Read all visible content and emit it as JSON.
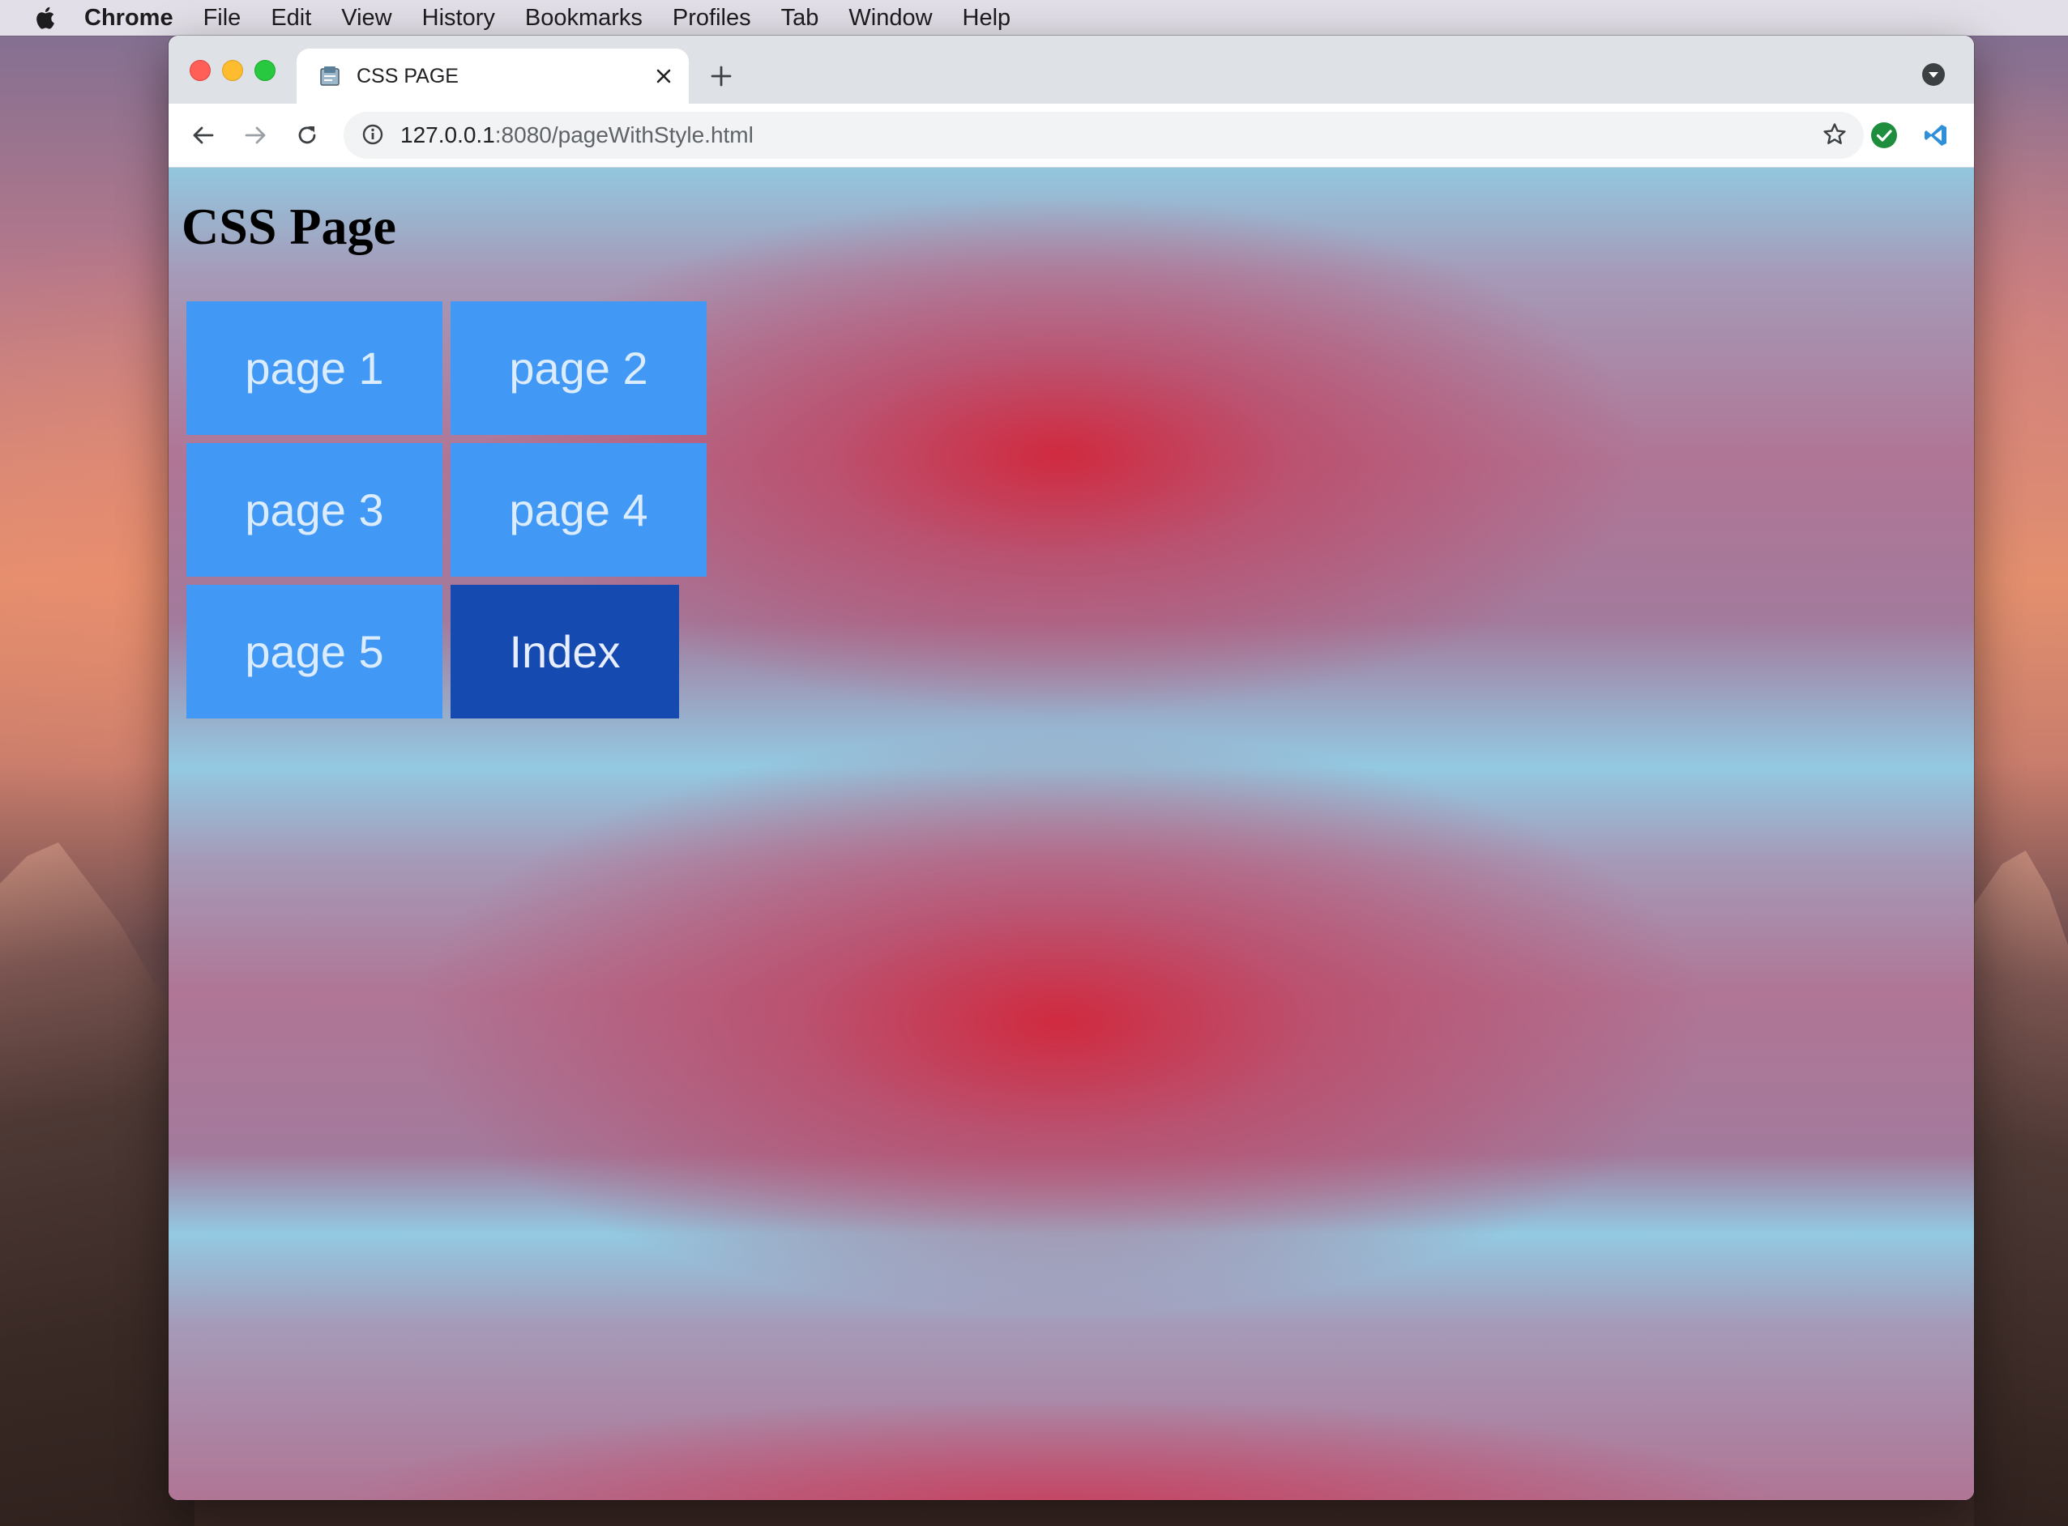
{
  "menubar": {
    "app_name": "Chrome",
    "items": [
      "File",
      "Edit",
      "View",
      "History",
      "Bookmarks",
      "Profiles",
      "Tab",
      "Window",
      "Help"
    ]
  },
  "browser": {
    "tab": {
      "title": "CSS PAGE"
    },
    "address": {
      "host": "127.0.0.1",
      "rest": ":8080/pageWithStyle.html"
    }
  },
  "page": {
    "heading": "CSS Page",
    "links": [
      {
        "label": "page 1",
        "style": "light"
      },
      {
        "label": "page 2",
        "style": "light"
      },
      {
        "label": "page 3",
        "style": "light"
      },
      {
        "label": "page 4",
        "style": "light"
      },
      {
        "label": "page 5",
        "style": "light"
      },
      {
        "label": "Index",
        "style": "dark"
      }
    ]
  },
  "colors": {
    "link_bg": "#4199f5",
    "link_active_bg": "#154bb0",
    "link_text": "#dcecff",
    "page_bg_red": "#d02a3f",
    "page_bg_blue": "#93c7df"
  },
  "icons": [
    "apple-icon",
    "favicon-icon",
    "close-icon",
    "plus-icon",
    "tab-search-icon",
    "back-arrow-icon",
    "forward-arrow-icon",
    "reload-icon",
    "info-icon",
    "star-icon",
    "check-extension-icon",
    "vscode-extension-icon",
    "puzzle-icon",
    "profile-icon",
    "kebab-menu-icon"
  ]
}
